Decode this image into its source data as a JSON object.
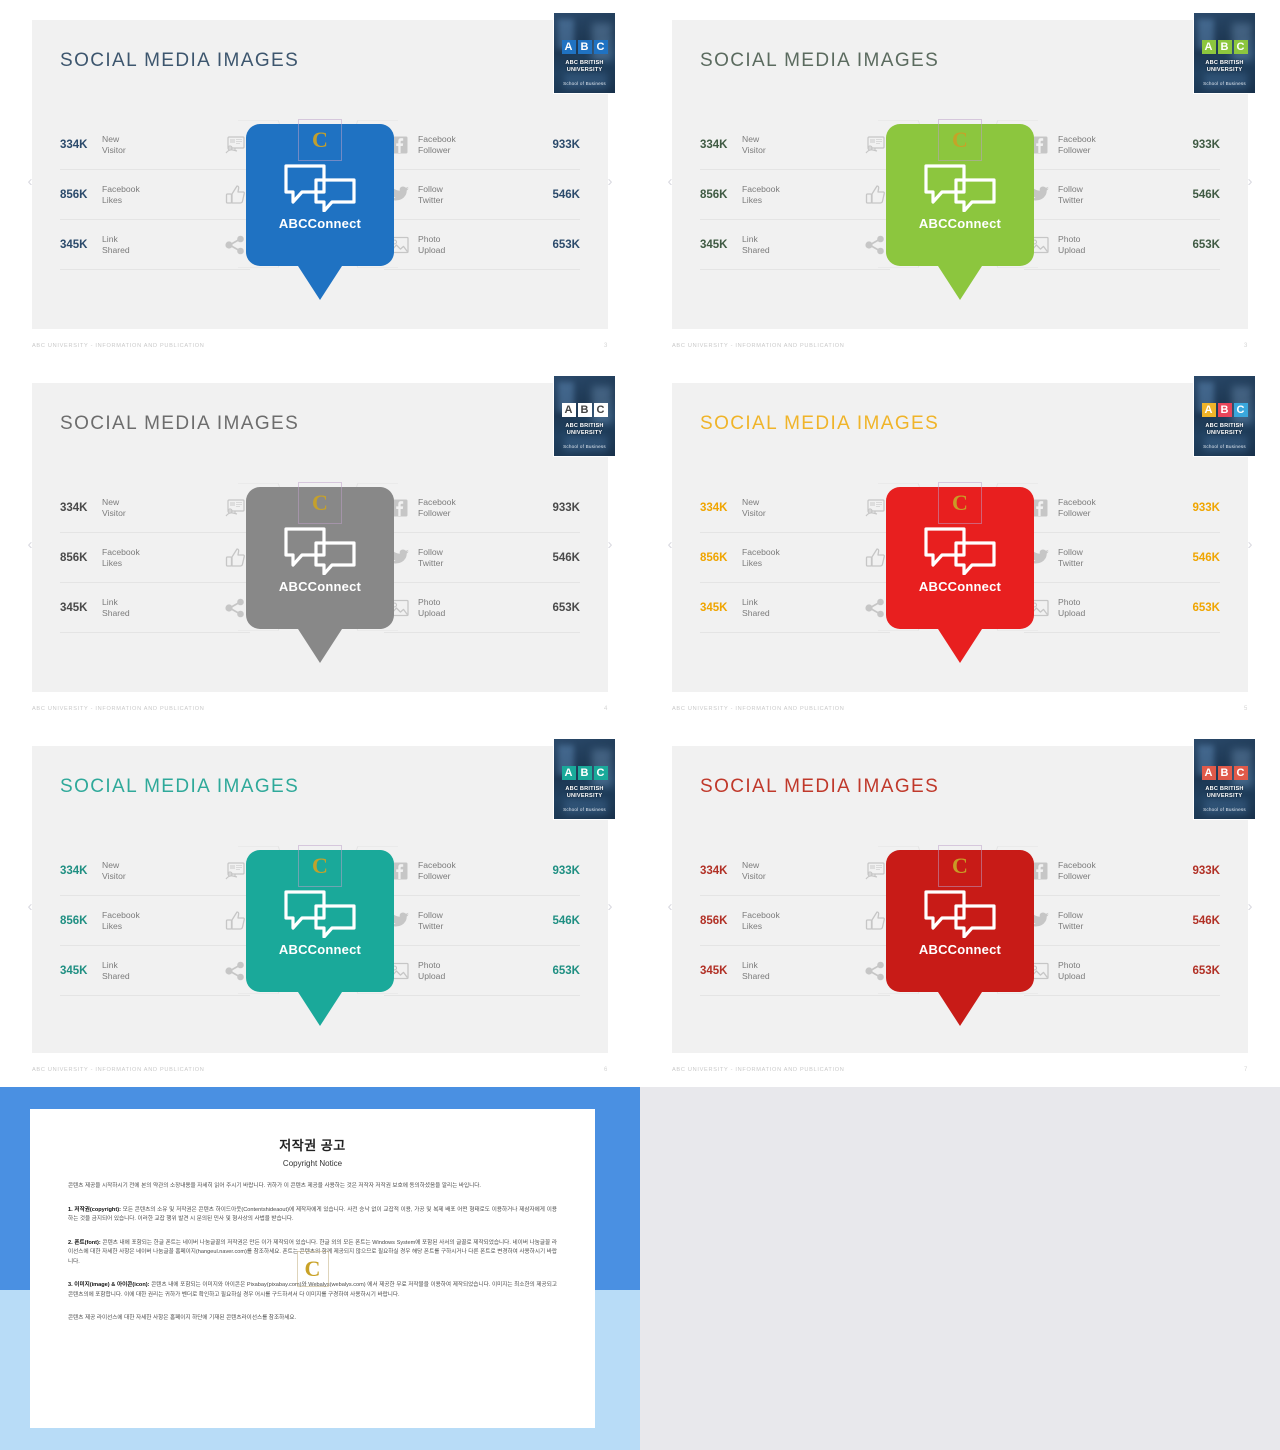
{
  "common": {
    "title": "SOCIAL MEDIA IMAGES",
    "brand_name": "ABCConnect",
    "footer_text": "ABC UNIVERSITY - INFORMATION AND PUBLICATION",
    "logo": {
      "letters": [
        "A",
        "B",
        "C"
      ],
      "name_line1": "ABC BRITISH",
      "name_line2": "UNIVERSITY",
      "subtitle": "School of Business"
    },
    "nav": {
      "prev": "‹",
      "next": "›"
    },
    "left_stats": [
      {
        "value": "334K",
        "label_line1": "New",
        "label_line2": "Visitor",
        "icon": "monitor-user-icon"
      },
      {
        "value": "856K",
        "label_line1": "Facebook",
        "label_line2": "Likes",
        "icon": "thumbs-up-icon"
      },
      {
        "value": "345K",
        "label_line1": "Link",
        "label_line2": "Shared",
        "icon": "share-nodes-icon"
      }
    ],
    "right_stats": [
      {
        "value": "933K",
        "label_line1": "Facebook",
        "label_line2": "Follower",
        "icon": "facebook-icon"
      },
      {
        "value": "546K",
        "label_line1": "Follow",
        "label_line2": "Twitter",
        "icon": "twitter-bird-icon"
      },
      {
        "value": "653K",
        "label_line1": "Photo",
        "label_line2": "Upload",
        "icon": "photo-image-icon"
      }
    ]
  },
  "slides": [
    {
      "id": "slide-blue",
      "page": "3",
      "title_color": "#3d566e",
      "value_color": "#2b4a6b",
      "badge_color": "#1f72c2",
      "logo_letter_bg": "#1f72c2",
      "logo_letter_colors": [
        "#1f72c2",
        "#1f72c2",
        "#1f72c2"
      ]
    },
    {
      "id": "slide-green",
      "page": "3",
      "title_color": "#5b6b5f",
      "value_color": "#3f5a43",
      "badge_color": "#8cc63e",
      "logo_letter_bg": "#8cc63e",
      "logo_letter_colors": [
        "#8cc63e",
        "#8cc63e",
        "#8cc63e"
      ]
    },
    {
      "id": "slide-gray",
      "page": "4",
      "title_color": "#6d6d6d",
      "value_color": "#4a4a4a",
      "badge_color": "#888888",
      "logo_letter_bg": "#ffffff",
      "logo_letter_colors": [
        "#ffffff",
        "#ffffff",
        "#ffffff"
      ]
    },
    {
      "id": "slide-yellow",
      "page": "5",
      "title_color": "#f0b429",
      "value_color": "#f0a500",
      "badge_color": "#e81f1f",
      "logo_letter_bg": "#f0b429",
      "logo_letter_colors": [
        "#f0b429",
        "#e8455a",
        "#3aa7dc"
      ]
    },
    {
      "id": "slide-teal",
      "page": "6",
      "title_color": "#2fa99a",
      "value_color": "#1f8f82",
      "badge_color": "#1aa99a",
      "logo_letter_bg": "#1aa99a",
      "logo_letter_colors": [
        "#1aa99a",
        "#1aa99a",
        "#1aa99a"
      ]
    },
    {
      "id": "slide-red",
      "page": "7",
      "title_color": "#c0392b",
      "value_color": "#b13025",
      "badge_color": "#c81b17",
      "logo_letter_bg": "#e05a4a",
      "logo_letter_colors": [
        "#e05a4a",
        "#e05a4a",
        "#e05a4a"
      ]
    }
  ],
  "copyright_slide": {
    "watermark": "C",
    "title_ko": "저작권 공고",
    "title_en": "Copyright Notice",
    "intro": "콘텐츠 제공을 시작하시기 전에 본의 약관의 소장내용을 자세히 읽어 주시기 바랍니다. 귀하가 이 콘텐츠 제공을 사용하는 것은 저작자 저작권 보호에 동의하셨음을 알리는 바입니다.",
    "clause1_title": "1. 저작권(copyright):",
    "clause1_body": "모든 콘텐츠의 소유 및 저작권은 콘텐츠 하이드아웃(Contentshideaout)에 제작자에게 있습니다. 사전 승낙 없이 교잡적 이용, 가공 및 복제 배포 어떤 형태로도 이용하거나 제삼자에게 이용하는 것을 금지되어 있습니다. 이러한 교잡 행위 발견 시 문의된 민사 및 형사상의 사법을 받습니다.",
    "clause2_title": "2. 폰트(font):",
    "clause2_body": "콘텐츠 내에 포함되는 한글 폰트는 네이버 나눔글꼴의 저작권은 만든 이가 제작되어 있습니다. 한글 외의 모든 폰트는 Windows System에 포함된 사서의 글꼴로 제작되었습니다. 네이버 나눔글꼴 라이선스에 대한 자세한 사항은 네이버 나눔글꼴 홈페이지(hangeul.naver.com)를 참조하세요. 폰트는 콘텐츠의 함께 제공되지 않으므로 필요하실 경우 해당 폰트를 구하시거나 다른 폰트로 변경하여 사용하시기 바랍니다.",
    "clause3_title": "3. 이미지(image) & 아이콘(icon):",
    "clause3_body": "콘텐츠 내에 포함되는 이미지와 아이콘은 Pixabay(pixabay.com)와 Webalys(webalys.com) 에서 제공한 무료 저작물을 이용하여 제작되었습니다. 이미지는 최소한의 제공되고 콘텐츠의에 포함합니다. 이에 대한 권리는 귀하가 벤더로 확인하고 필요하실 경우 어시를 구드하셔서 다 이미지를 구경하여 사용하시기 바랍니다.",
    "outro": "콘텐츠 제공 라이선스에 대한 자세한 사항은 홈페이지 하단에 기재된 콘텐츠라이선스를 참조하세요."
  }
}
